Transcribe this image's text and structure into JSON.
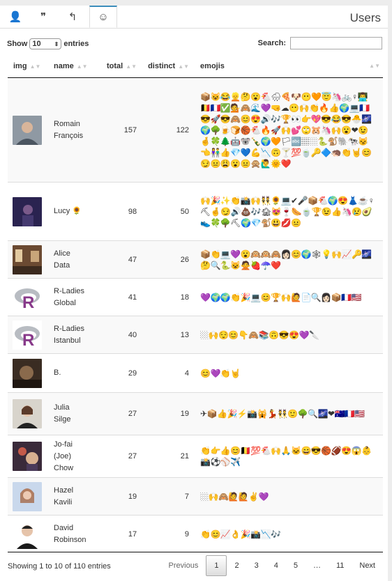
{
  "app": {
    "title": "Users"
  },
  "tabs": [
    {
      "icon": "user-icon",
      "glyph": "👤"
    },
    {
      "icon": "quote-icon",
      "glyph": "❞"
    },
    {
      "icon": "reply-icon",
      "glyph": "↰"
    },
    {
      "icon": "smiley-icon",
      "glyph": "☺"
    }
  ],
  "controls": {
    "show_label": "Show",
    "entries_value": "10",
    "entries_label": "entries",
    "search_label": "Search:",
    "search_value": ""
  },
  "columns": [
    "img",
    "name",
    "total",
    "distinct",
    "emojis"
  ],
  "rows": [
    {
      "name1": "Romain",
      "name2": "François",
      "name3": "",
      "total": "157",
      "distinct": "122",
      "avatar": "photo",
      "emojis": "📦😺😂👱🤔😮🐔🌧🍕🐶😶🧡😇🦄🚲♀👨‍💻🇧🇪🇫🇷✅💁🙈🌊💜🤜☁😶🙌👏🔥👍🌍💻🇫🇷😎🚀😎🙈😊😍🔊🎶🏆👀👉💖😎😂😎🐣🌌🌍🌳🍺🍞🏀🐔🔥🚀🙌💕🙄🐹🦄🙌😮❤😉🤞🍀🌲🤖🐨🍾🌍🧡🏳🔤🏽🏼🐍🐒🐘🐄😼👈👫👍💎💙💪📉🙃🍸💯🍵🔑🔷🦔👏🤘😊😏😐😩😮😐🙊🙋‍♂️🌞❤️"
    },
    {
      "name1": "Lucy 🌻",
      "name2": "",
      "name3": "",
      "total": "98",
      "distinct": "50",
      "avatar": "dark",
      "emojis": "🙌🎉✨👏📸🙌👯🌻💻✔🎤📦🐔🌍😍👗☕♀⛏🤞😏🔊💩🎶🏚😻🍷🌭🍵🏆😉👍🦄😢🥑👟🍀🌳⛏🌍💎🐒😃💋😐"
    },
    {
      "name1": "Alice",
      "name2": "Data",
      "name3": "",
      "total": "47",
      "distinct": "26",
      "avatar": "room",
      "emojis": "📦👏💻💜😮🙉🙉🙈👩🏻😊🌍🕸💡🙌📈🔑🌌🤔🔍🐍😺🙅🍓☂️❤️"
    },
    {
      "name1": "R-Ladies",
      "name2": "Global",
      "name3": "",
      "total": "41",
      "distinct": "18",
      "avatar": "rlogo",
      "emojis": "💜🌍🌍👏🎉💻😊🏆🙌🙋📄🔍👩🏻📦🇫🇷🇺🇸"
    },
    {
      "name1": "R-Ladies",
      "name2": "Istanbul",
      "name3": "",
      "total": "40",
      "distinct": "13",
      "avatar": "rlogo",
      "emojis": "🏼🙌😌😊👇🙈📚🙃😎😍💜🔪"
    },
    {
      "name1": "B.",
      "name2": "",
      "name3": "",
      "total": "29",
      "distinct": "4",
      "avatar": "dark2",
      "emojis": "😊💜👏🤘"
    },
    {
      "name1": "Julia",
      "name2": "Silge",
      "name3": "",
      "total": "27",
      "distinct": "19",
      "avatar": "julia",
      "emojis": "✈📦👍🎉⚡📸🙀💃👯🙂🌳🔍🌌❤🇦🇺🇫🇷🇺🇸"
    },
    {
      "name1": "Jo-fai",
      "name2": "(Joe)",
      "name3": "Chow",
      "total": "27",
      "distinct": "21",
      "avatar": "jo",
      "emojis": "👏👉👍😊🇧🇪💯🐔🙌🙏🐱😄😎🏀🏈😍😱👶📸⚽⚾✈️"
    },
    {
      "name1": "Hazel",
      "name2": "Kavili",
      "name3": "",
      "total": "19",
      "distinct": "7",
      "avatar": "hazel",
      "emojis": "🏼🙌🙈🙋🙋✌💜"
    },
    {
      "name1": "David",
      "name2": "Robinson",
      "name3": "",
      "total": "17",
      "distinct": "9",
      "avatar": "david",
      "emojis": "👏😊📈👌🎉📸📉🎶"
    }
  ],
  "footer": {
    "info": "Showing 1 to 10 of 110 entries",
    "prev": "Previous",
    "pages": [
      "1",
      "2",
      "3",
      "4",
      "5",
      "…",
      "11"
    ],
    "next": "Next"
  }
}
